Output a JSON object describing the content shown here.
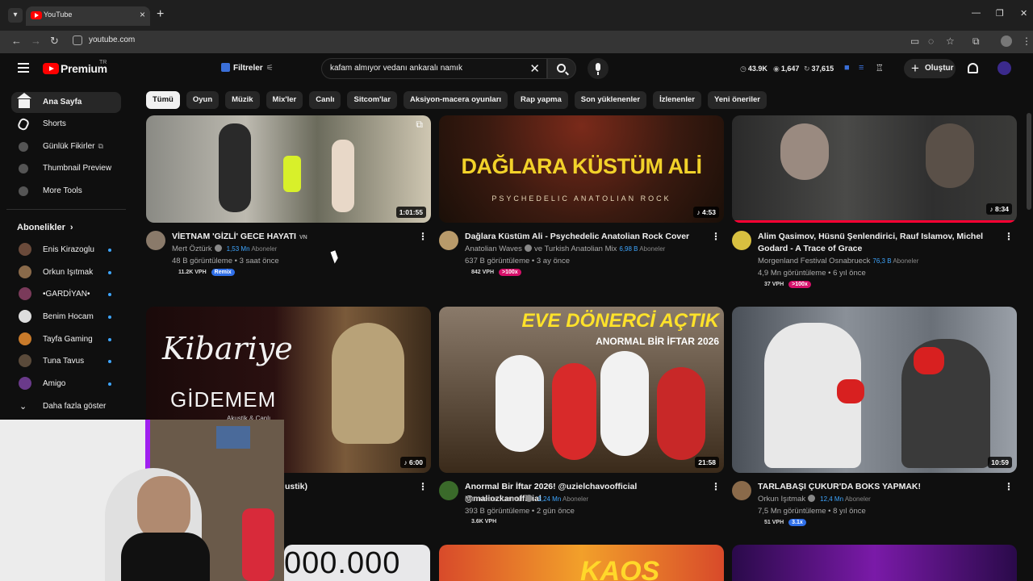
{
  "browser": {
    "tab_title": "YouTube",
    "url": "youtube.com"
  },
  "header": {
    "logo_text": "Premium",
    "logo_sup": "TR",
    "filters_label": "Filtreler",
    "search_query": "kafam almıyor vedanı ankaralı namık",
    "stats": [
      "43.9K",
      "1,647",
      "37,615"
    ],
    "create_label": "Oluştur"
  },
  "chips": [
    "Tümü",
    "Oyun",
    "Müzik",
    "Mix'ler",
    "Canlı",
    "Sitcom'lar",
    "Aksiyon-macera oyunları",
    "Rap yapma",
    "Son yüklenenler",
    "İzlenenler",
    "Yeni öneriler"
  ],
  "sidebar": {
    "items": [
      {
        "label": "Ana Sayfa",
        "icon": "home-icon"
      },
      {
        "label": "Shorts",
        "icon": "shorts-icon"
      },
      {
        "label": "Günlük Fikirler",
        "icon": "extension-icon"
      },
      {
        "label": "Thumbnail Preview",
        "icon": "extension-icon"
      },
      {
        "label": "More Tools",
        "icon": "extension-icon"
      }
    ],
    "section_title": "Abonelikler",
    "subscriptions": [
      {
        "label": "Enis Kirazoglu",
        "color": "#6a4a3a"
      },
      {
        "label": "Orkun Işıtmak",
        "color": "#8a6a4a"
      },
      {
        "label": "•GARDİYAN•",
        "color": "#7a3a5a"
      },
      {
        "label": "Benim Hocam",
        "color": "#dddddd"
      },
      {
        "label": "Tayfa Gaming",
        "color": "#c87a2a"
      },
      {
        "label": "Tuna Tavus",
        "color": "#5a4a3a"
      },
      {
        "label": "Amigo",
        "color": "#6a3a8a"
      }
    ],
    "show_more": "Daha fazla göster"
  },
  "videos": [
    {
      "title": "VİETNAM 'GİZLİ' GECE HAYATI",
      "title_suffix": "VN",
      "channel": "Mert Öztürk",
      "subs": "1,53 Mn",
      "subs_suffix": "Aboneler",
      "views": "48 B görüntüleme • 3 saat önce",
      "duration": "1:01:55",
      "vph": "11.2K VPH",
      "pill": "Remix",
      "pill_color": "blue"
    },
    {
      "title": "Dağlara Küstüm Ali - Psychedelic Anatolian Rock Cover",
      "channel": "Anatolian Waves",
      "channel_extra": "ve Turkish Anatolian Mix",
      "subs": "6,98 B",
      "subs_suffix": "Aboneler",
      "views": "637 B görüntüleme • 3 ay önce",
      "duration": "4:53",
      "vph": "842 VPH",
      "pill": ">100x",
      "pill_color": "pink",
      "thumb_title": "DAĞLARA KÜSTÜM ALİ",
      "thumb_sub": "PSYCHEDELIC ANATOLIAN ROCK"
    },
    {
      "title": "Alim Qasimov, Hüsnü Şenlendirici, Rauf Islamov, Michel Godard - A Trace of Grace",
      "channel": "Morgenland Festival Osnabrueck",
      "subs": "76,3 B",
      "subs_suffix": "Aboneler",
      "views": "4,9 Mn görüntüleme • 6 yıl önce",
      "duration": "8:34",
      "vph": "37 VPH",
      "pill": ">100x",
      "pill_color": "pink"
    },
    {
      "title": "ustik)",
      "duration": "6:00",
      "thumb_script": "Kibariye",
      "thumb_title": "GİDEMEM",
      "thumb_sub": "Akustik & Canlı"
    },
    {
      "title": "Anormal Bir İftar 2026! @uzielchavoofficial @maliozkanofficial",
      "channel": "Mendebur Lemur",
      "subs": "3,24 Mn",
      "subs_suffix": "Aboneler",
      "views": "393 B görüntüleme • 2 gün önce",
      "duration": "21:58",
      "vph": "3.6K VPH",
      "thumb_title": "EVE DÖNERCİ AÇTIK",
      "thumb_sub": "ANORMAL BİR İFTAR 2026"
    },
    {
      "title": "TARLABAŞI ÇUKUR'DA BOKS YAPMAK!",
      "channel": "Orkun Işıtmak",
      "subs": "12,4 Mn",
      "subs_suffix": "Aboneler",
      "views": "7,5 Mn görüntüleme • 8 yıl önce",
      "duration": "10:59",
      "vph": "51 VPH",
      "pill": "3.1x",
      "pill_color": "blue"
    }
  ],
  "bottom_thumbs": {
    "left_text": "000.000",
    "middle_text": "KAOS"
  }
}
